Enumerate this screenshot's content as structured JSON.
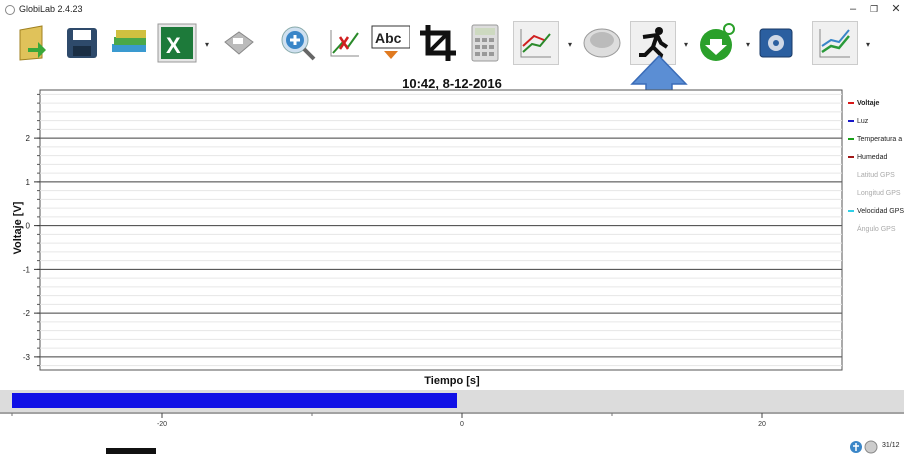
{
  "window": {
    "title": "GlobiLab 2.4.23",
    "minimize": "–",
    "maximize": "❐",
    "close": "✕"
  },
  "header": {
    "timestamp": "10:42, 8-12-2016"
  },
  "toolbar": {
    "items": [
      {
        "name": "open-icon",
        "color": "#d9b43a"
      },
      {
        "name": "save-icon",
        "color": "#2e4a6b"
      },
      {
        "name": "library-icon",
        "color": "#4aa84a"
      },
      {
        "name": "excel-icon",
        "color": "#1d7a3a"
      },
      {
        "name": "print-icon",
        "color": "#999999"
      },
      {
        "name": "zoom-in-icon",
        "color": "#3a86c8"
      },
      {
        "name": "graph-edit-icon",
        "color": "#c03030"
      },
      {
        "name": "text-label-icon",
        "label": "Abc"
      },
      {
        "name": "crop-icon",
        "color": "#111111"
      },
      {
        "name": "calculator-icon",
        "color": "#bbbbbb"
      },
      {
        "name": "graph-type-icon",
        "color": "#c03030"
      },
      {
        "name": "logger-icon",
        "color": "#bbbbbb"
      },
      {
        "name": "run-icon",
        "color": "#111111"
      },
      {
        "name": "download-icon",
        "color": "#2aa02a"
      },
      {
        "name": "settings-icon",
        "color": "#2b5fa0"
      },
      {
        "name": "display-icon",
        "color": "#2a9a3a"
      }
    ]
  },
  "chart_data": {
    "type": "line",
    "ylabel": "Voltaje [V]",
    "xlabel": "Tiempo [s]",
    "ylim": [
      -3,
      3
    ],
    "yticks": [
      "2",
      "1",
      "0",
      "-1",
      "-2",
      "-3"
    ],
    "grid": true,
    "legend_position": "right",
    "series": []
  },
  "legend": [
    {
      "label": "Voltaje",
      "color": "#d81818",
      "bold": true
    },
    {
      "label": "Luz",
      "color": "#1818c8"
    },
    {
      "label": "Temperatura a",
      "color": "#18a018"
    },
    {
      "label": "Humedad",
      "color": "#a01818"
    },
    {
      "label": "Latitud GPS",
      "color": "",
      "dim": true
    },
    {
      "label": "Longitud GPS",
      "color": "",
      "dim": true
    },
    {
      "label": "Velocidad GPS",
      "color": "#30d0e8"
    },
    {
      "label": "Ángulo GPS",
      "color": "",
      "dim": true
    }
  ],
  "progress": {
    "value_fraction": 0.5,
    "color": "#1010e6"
  },
  "timeline": {
    "ticks": [
      "-20",
      "0",
      "20"
    ]
  },
  "tray": {
    "date": "31/12"
  }
}
